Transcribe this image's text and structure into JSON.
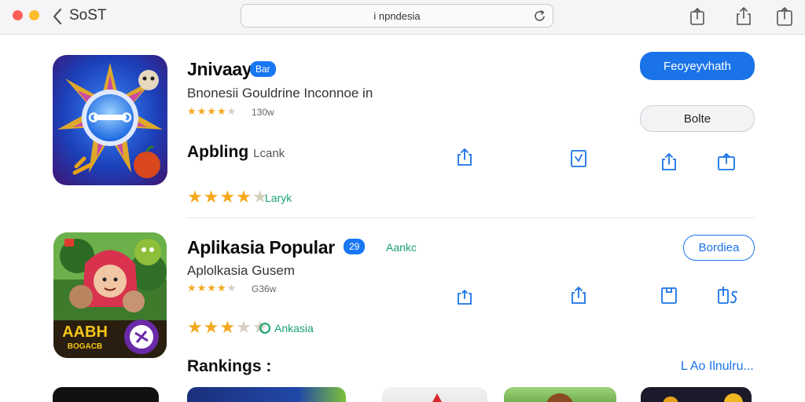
{
  "toolbar": {
    "title": "SoST",
    "address": "i npndesia"
  },
  "apps": [
    {
      "name": "Jnivaay",
      "badge": "Bar",
      "subtitle": "Bnonesii Gouldrine Inconnoe in",
      "rating_count": "130w",
      "section_label": "Apbling",
      "section_sub": "Lcank",
      "secondary_text": "Laryk",
      "primary_button": "Feoyeyvhath",
      "secondary_button": "Bolte"
    },
    {
      "name": "Aplikasia Popular",
      "badge": "29",
      "badge_side_text": "Aankc",
      "subtitle": "Aplolkasia Gusem",
      "rating_count": "G36w",
      "secondary_text": "Ankasia",
      "outline_button": "Bordiea"
    }
  ],
  "rankings": {
    "title": "Rankings :",
    "link": "L Ao Ilnulru..."
  },
  "colors": {
    "accent": "#1a73e8",
    "star": "#f4a81d",
    "green": "#1aa36e"
  },
  "icons": [
    "back-icon",
    "reload-icon",
    "share-icon",
    "bookmark-icon",
    "star-icon"
  ]
}
